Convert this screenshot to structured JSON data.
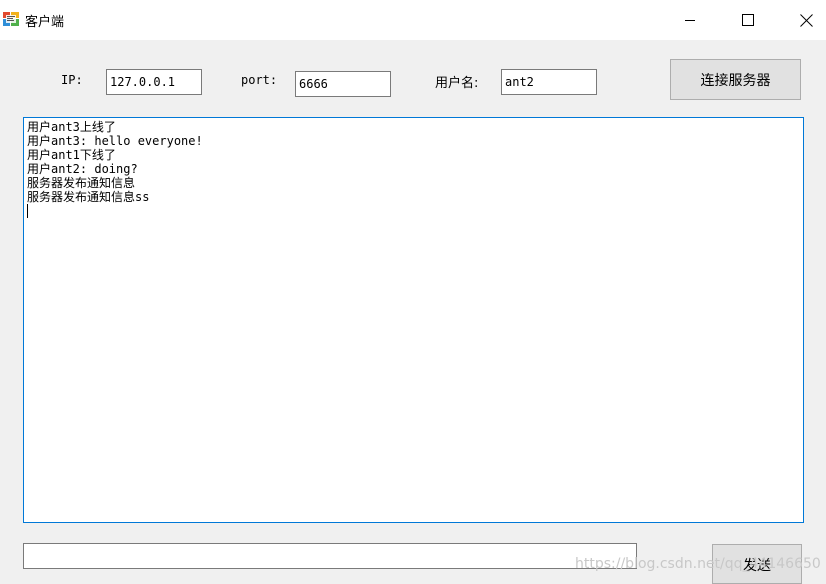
{
  "window": {
    "title": "客户端",
    "icon": "app-window-icon",
    "controls": [
      "minimize-icon",
      "maximize-icon",
      "close-icon"
    ]
  },
  "connection": {
    "ip_label": "IP:",
    "ip_value": "127.0.0.1",
    "port_label": "port:",
    "port_value": "6666",
    "username_label": "用户名:",
    "username_value": "ant2",
    "connect_button": "连接服务器"
  },
  "chat_log": [
    "用户ant3上线了",
    "用户ant3: hello everyone!",
    "用户ant1下线了",
    "用户ant2: doing?",
    "服务器发布通知信息",
    "服务器发布通知信息ss"
  ],
  "compose": {
    "input_value": "",
    "send_button": "发送"
  },
  "watermark": "https://blog.csdn.net/qq_44146650",
  "colors": {
    "focus_border": "#0078d7",
    "button_face": "#e1e1e1",
    "window_bg": "#f0f0f0"
  }
}
